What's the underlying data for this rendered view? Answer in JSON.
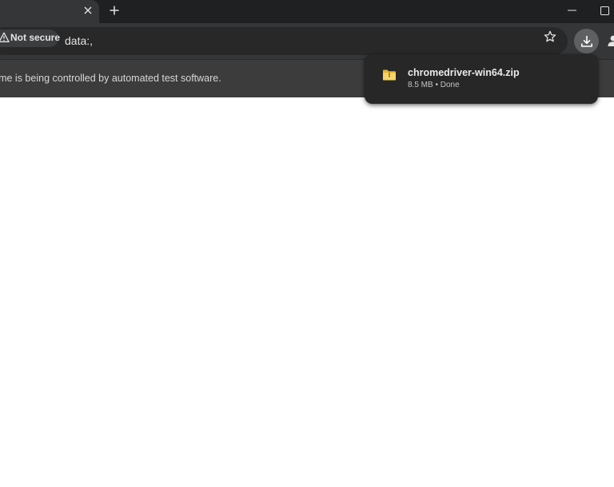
{
  "browser": {
    "security_label": "Not secure",
    "url": "data:,",
    "infobar_text": "Chrome is being controlled by automated test software."
  },
  "download_bubble": {
    "file_name": "chromedriver-win64.zip",
    "status": "8.5 MB • Done"
  },
  "icons": {
    "tab_close": "close-icon",
    "new_tab": "plus-icon",
    "minimize": "minimize-icon",
    "maximize": "maximize-icon",
    "warning": "warning-icon",
    "star": "star-icon",
    "download": "download-icon",
    "profile": "profile-icon",
    "file": "zip-folder-icon"
  },
  "colors": {
    "tabstrip": "#1f2021",
    "toolbar": "#353637",
    "omnibox": "#282828",
    "infobar": "#3c3c3c",
    "bubble": "#272727",
    "folder": "#f2c94c"
  }
}
